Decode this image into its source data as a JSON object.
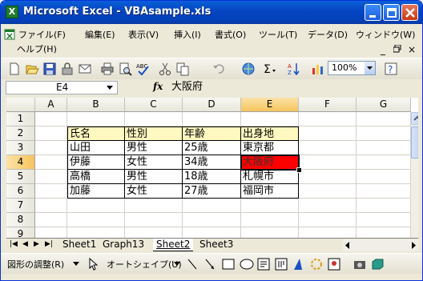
{
  "window": {
    "title": "Microsoft Excel - VBAsample.xls",
    "app_icon_letter": "X",
    "title_color": "#0546c3"
  },
  "menu": {
    "items": [
      "ファイル(F)",
      "編集(E)",
      "表示(V)",
      "挿入(I)",
      "書式(O)",
      "ツール(T)",
      "データ(D)",
      "ウィンドウ(W)"
    ],
    "help": "ヘルプ(H)",
    "doc_controls": [
      "_",
      "×"
    ]
  },
  "toolbar": {
    "zoom": "100%",
    "icons": [
      "new-icon",
      "open-icon",
      "save-icon",
      "permission-icon",
      "email-icon",
      "print-icon",
      "print-preview-icon",
      "spelling-icon",
      "cut-icon",
      "copy-icon",
      "undo-icon",
      "hyperlink-icon",
      "autosum-icon",
      "sort-ascending-icon",
      "chart-wizard-icon",
      "help-icon"
    ]
  },
  "formula_bar": {
    "name_box": "E4",
    "fx": "fx",
    "content": "大阪府"
  },
  "grid": {
    "columns": [
      "A",
      "B",
      "C",
      "D",
      "E",
      "F",
      "G"
    ],
    "rows": [
      "1",
      "2",
      "3",
      "4",
      "5",
      "6",
      "7",
      "8",
      "9"
    ],
    "active_column": "E",
    "active_row": "4",
    "table": {
      "header": [
        "氏名",
        "性別",
        "年齢",
        "出身地"
      ],
      "rows": [
        [
          "山田",
          "男性",
          "25歳",
          "東京都"
        ],
        [
          "伊藤",
          "女性",
          "34歳",
          "大阪府"
        ],
        [
          "高橋",
          "男性",
          "18歳",
          "札幌市"
        ],
        [
          "加藤",
          "女性",
          "27歳",
          "福岡市"
        ]
      ],
      "header_fill": "#fff8c0",
      "highlight_fill": "#ff0000"
    }
  },
  "sheets": {
    "tabs": [
      "Sheet1",
      "Graph13",
      "Sheet2",
      "Sheet3"
    ],
    "active": "Sheet2"
  },
  "drawing_toolbar": {
    "draw_menu": "図形の調整(R)",
    "autoshapes": "オートシェイプ(U)"
  }
}
